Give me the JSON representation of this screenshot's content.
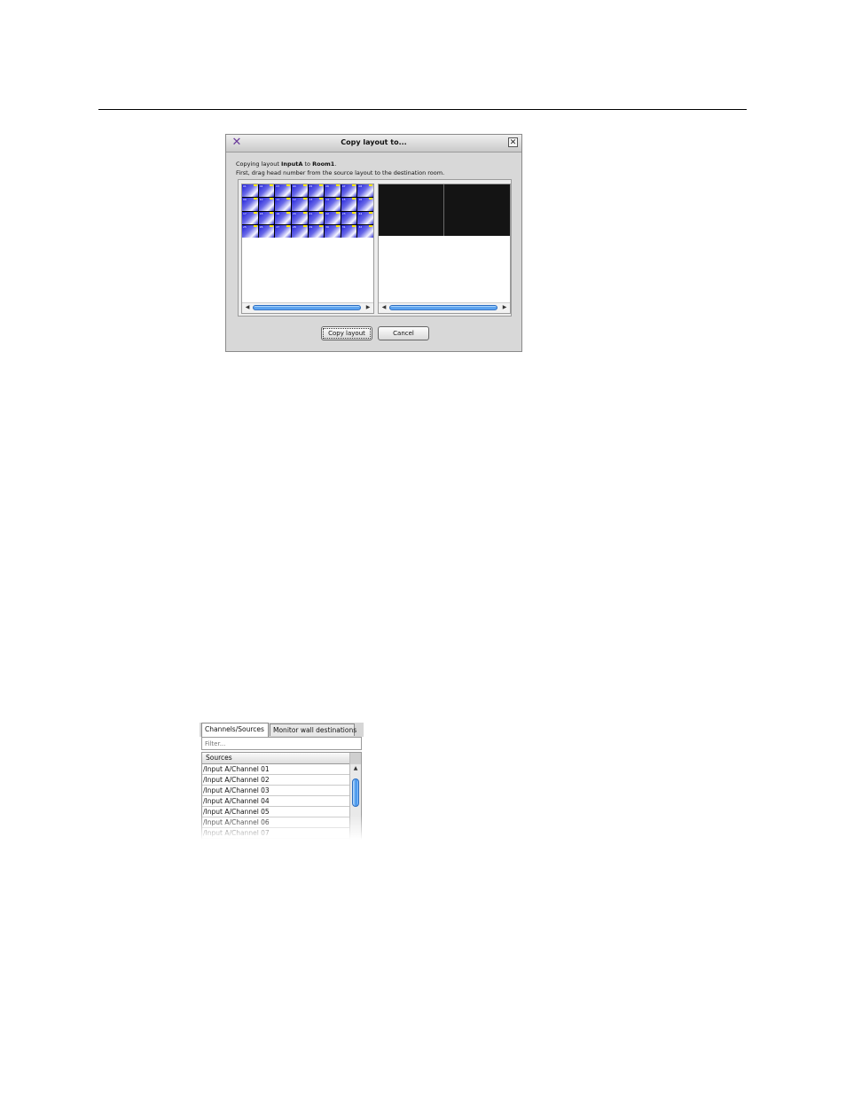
{
  "dialog": {
    "title": "Copy layout to...",
    "message": {
      "prefix": "Copying layout ",
      "layout_name": "InputA",
      "middle": " to ",
      "room_name": "Room1",
      "suffix": ".",
      "instruction": "First, drag head number from the source layout to the destination room."
    },
    "source_tiles": [
      "01",
      "02",
      "03",
      "04",
      "05",
      "06",
      "07",
      "08",
      "09",
      "10",
      "11",
      "12",
      "13",
      "14",
      "15",
      "16",
      "17",
      "18",
      "19",
      "20",
      "21",
      "22",
      "23",
      "24",
      "25",
      "26",
      "27",
      "28",
      "29",
      "30",
      "31",
      "32"
    ],
    "copy_button": "Copy layout",
    "cancel_button": "Cancel",
    "colors": {
      "tile_blue": "#1a1ad8",
      "monitor_black": "#141414",
      "scroll_blue": "#3a8ee8"
    }
  },
  "panel": {
    "tabs": [
      {
        "label": "Channels/Sources",
        "active": true
      },
      {
        "label": "Monitor wall destinations",
        "active": false
      }
    ],
    "filter_placeholder": "Filter...",
    "column_header": "Sources",
    "rows": [
      "/Input A/Channel 01",
      "/Input A/Channel 02",
      "/Input A/Channel 03",
      "/Input A/Channel 04",
      "/Input A/Channel 05",
      "/Input A/Channel 06",
      "/Input A/Channel 07"
    ]
  }
}
